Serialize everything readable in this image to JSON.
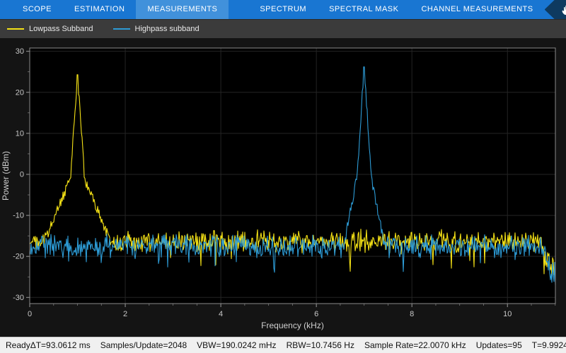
{
  "toolbar": {
    "tabs": [
      {
        "label": "SCOPE",
        "active": false,
        "section": "scope"
      },
      {
        "label": "ESTIMATION",
        "active": false,
        "section": "scope"
      },
      {
        "label": "MEASUREMENTS",
        "active": true,
        "section": "scope"
      },
      {
        "label": "SPECTRUM",
        "active": false,
        "section": "spectrum"
      },
      {
        "label": "SPECTRAL MASK",
        "active": false,
        "section": "spectrum"
      },
      {
        "label": "CHANNEL MEASUREMENTS",
        "active": false,
        "section": "spectrum"
      }
    ],
    "more_label": "...",
    "accent_color": "#1976D2",
    "active_tab_color": "#4191DB",
    "collapse_badge_color": "#0E3A60"
  },
  "legend": {
    "items": [
      {
        "label": "Lowpass Subband",
        "color": "#F5E216"
      },
      {
        "label": "Highpass subband",
        "color": "#2D9BD5"
      }
    ]
  },
  "chart_data": {
    "type": "line",
    "title": "",
    "xlabel": "Frequency (kHz)",
    "ylabel": "Power (dBm)",
    "xlim": [
      0,
      11.0035
    ],
    "ylim": [
      -31.5,
      30.8
    ],
    "x_ticks": [
      0,
      2,
      4,
      6,
      8,
      10
    ],
    "y_ticks": [
      -30,
      -20,
      -10,
      0,
      10,
      20,
      30
    ],
    "grid": true,
    "background": "#000000",
    "legend_position": "top-bar",
    "nyquist_rolloff_start_khz": 10.72,
    "series": [
      {
        "name": "Lowpass Subband",
        "color": "#F5E216",
        "peak_freq_khz": 1.0,
        "peak_power_dbm": 24.3,
        "noise_floor_dbm": -16.3,
        "skirt": {
          "inner_slope_db_per_khz": 170,
          "outer_slope_db_per_khz": 28,
          "transition_khz": 0.15
        }
      },
      {
        "name": "Highpass subband",
        "color": "#2D9BD5",
        "peak_freq_khz": 7.0,
        "peak_power_dbm": 26.2,
        "noise_floor_dbm": -17.5,
        "skirt": {
          "inner_slope_db_per_khz": 180,
          "outer_slope_db_per_khz": 60,
          "transition_khz": 0.15
        }
      }
    ]
  },
  "status_bar": {
    "state": "Ready",
    "metrics": [
      "ΔT=93.0612 ms",
      "Samples/Update=2048",
      "VBW=190.0242 mHz",
      "RBW=10.7456 Hz",
      "Sample Rate=22.0070 kHz",
      "Updates=95",
      "T=9.9924"
    ]
  }
}
